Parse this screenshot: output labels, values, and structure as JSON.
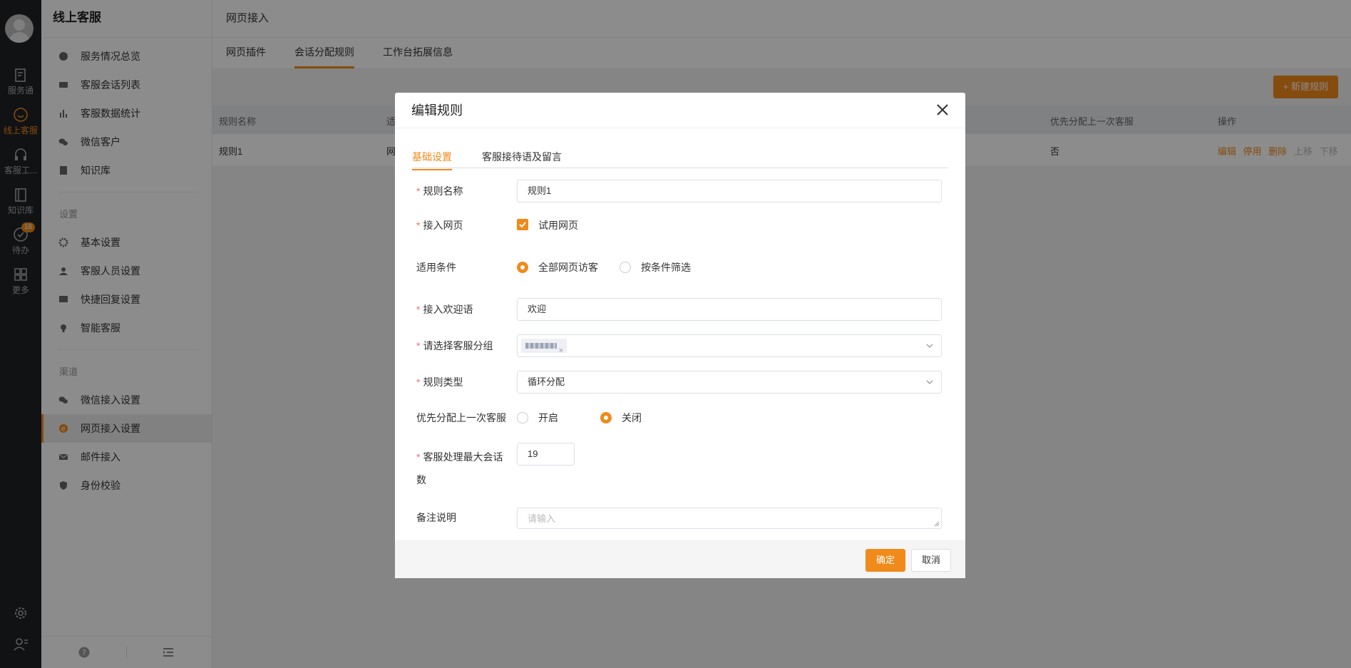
{
  "rail": {
    "items": [
      {
        "label": "服务通",
        "icon": "clipboard-icon"
      },
      {
        "label": "线上客服",
        "icon": "smile-icon",
        "active": true
      },
      {
        "label": "客服工...",
        "icon": "headset-icon"
      },
      {
        "label": "知识库",
        "icon": "book-icon"
      },
      {
        "label": "待办",
        "icon": "check-circle-icon",
        "badge": "16"
      },
      {
        "label": "更多",
        "icon": "grid-icon"
      }
    ]
  },
  "sidebar": {
    "title": "线上客服",
    "items": [
      "服务情况总览",
      "客服会话列表",
      "客服数据统计",
      "微信客户",
      "知识库"
    ],
    "group_settings": "设置",
    "settings_items": [
      "基本设置",
      "客服人员设置",
      "快捷回复设置",
      "智能客服"
    ],
    "group_channels": "渠道",
    "channel_items": [
      "微信接入设置",
      "网页接入设置",
      "邮件接入",
      "身份校验"
    ]
  },
  "main": {
    "title": "网页接入",
    "tabs": [
      "网页插件",
      "会话分配规则",
      "工作台拓展信息"
    ],
    "new_button": "+ 新建规则",
    "table": {
      "headers": [
        "规则名称",
        "适",
        "优先分配上一次客服",
        "操作"
      ],
      "row": {
        "name": "规则1",
        "col2": "网",
        "priority": "否"
      },
      "ops": [
        "编辑",
        "停用",
        "删除",
        "上移",
        "下移"
      ]
    }
  },
  "modal": {
    "title": "编辑规则",
    "tabs": [
      "基础设置",
      "客服接待语及留言"
    ],
    "fields": {
      "rule_name": {
        "label": "规则名称",
        "value": "规则1"
      },
      "page": {
        "label": "接入网页",
        "option": "试用网页"
      },
      "condition": {
        "label": "适用条件",
        "options": [
          "全部网页访客",
          "按条件筛选"
        ],
        "selected": "全部网页访客"
      },
      "welcome": {
        "label": "接入欢迎语",
        "value": "欢迎"
      },
      "group": {
        "label": "请选择客服分组"
      },
      "rule_type": {
        "label": "规则类型",
        "value": "循环分配"
      },
      "priority": {
        "label": "优先分配上一次客服",
        "options": [
          "开启",
          "关闭"
        ],
        "selected": "关闭"
      },
      "max_sessions": {
        "label_1": "客服处理最大会话",
        "label_2": "数",
        "value": "19"
      },
      "remark": {
        "label": "备注说明",
        "placeholder": "请输入"
      }
    },
    "ok": "确定",
    "cancel": "取消"
  },
  "colors": {
    "accent": "#f08a1a",
    "rail_bg": "#1f2125"
  }
}
